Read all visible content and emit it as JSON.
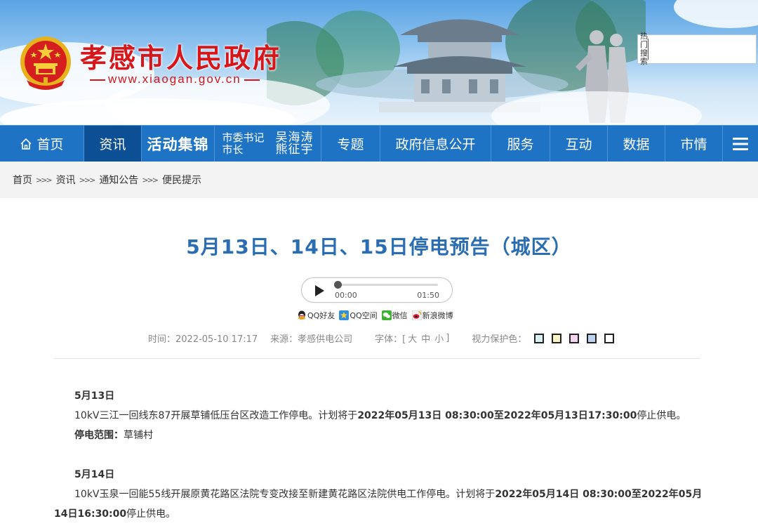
{
  "header": {
    "site_title": "孝感市人民政府",
    "site_url": "www.xiaogan.gov.cn",
    "search": {
      "label_line1": "热门",
      "label_line2": "搜索",
      "value": ""
    }
  },
  "nav": {
    "home": "首页",
    "news": "资讯",
    "activity": "活动集锦",
    "leader1_title": "市委书记",
    "leader1_name": "吴海涛",
    "leader2_title": "市长",
    "leader2_name": "熊征宇",
    "topic": "专题",
    "gov_info": "政府信息公开",
    "service": "服务",
    "interact": "互动",
    "data": "数据",
    "city": "市情"
  },
  "breadcrumb": [
    "首页",
    "资讯",
    "通知公告",
    "便民提示"
  ],
  "breadcrumb_sep": ">>>",
  "article": {
    "title": "5月13日、14日、15日停电预告（城区）",
    "audio": {
      "current": "00:00",
      "total": "01:50",
      "progress": 0.0
    },
    "share": [
      "QQ好友",
      "QQ空间",
      "微信",
      "新浪微博"
    ],
    "meta": {
      "time": "时间：2022-05-10 17:17",
      "source": "来源：孝感供电公司",
      "font_label": "字体：[",
      "font_large": "大",
      "font_medium": "中",
      "font_small": "小",
      "font_end": "]",
      "eye_label": "视力保护色："
    },
    "swatch_colors": [
      "#d9f0f5",
      "#fbf5c8",
      "#f5d4ef",
      "#bcd4f0",
      "#ffffff"
    ],
    "sections": [
      {
        "date": "5月13日",
        "text_pre": "10kV三江一回线东87开展草铺低压台区改造工作停电。计划将于",
        "text_bold": "2022年05月13日 08:30:00至2022年05月13日17:30:00",
        "text_post": "停止供电。",
        "scope_label": "停电范围：",
        "scope": "草铺村"
      },
      {
        "date": "5月14日",
        "text_pre": "10kV玉泉一回能55线开展原黄花路区法院专变改接至新建黄花路区法院供电工作停电。计划将于",
        "text_bold": "2022年05月14日 08:30:00至2022年05月14日16:30:00",
        "text_post": "停止供电。"
      }
    ]
  }
}
